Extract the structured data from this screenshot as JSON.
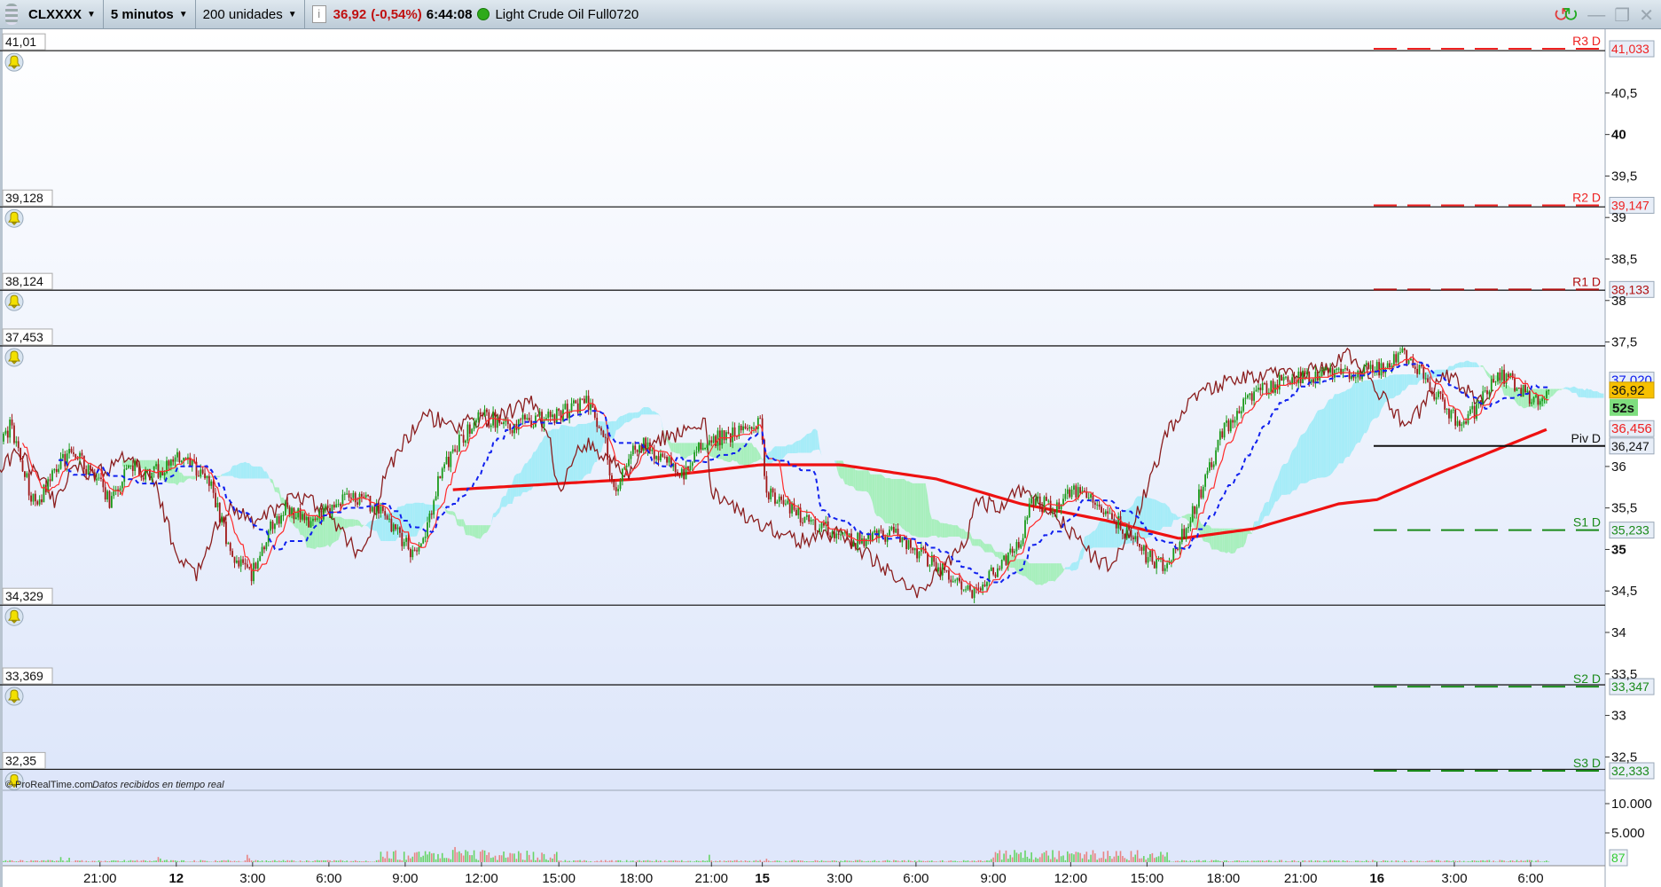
{
  "toolbar": {
    "symbol": "CLXXXX",
    "timeframe": "5 minutos",
    "units": "200 unidades",
    "price": "36,92",
    "change": "(-0,54%)",
    "time": "6:44:08",
    "instrument": "Light Crude Oil Full0720"
  },
  "colors": {
    "up": "#1a9a1a",
    "down": "#a01818",
    "tenkan": "#ff2a2a",
    "kijun": "#1020ee",
    "chikou": "#8b1e1e",
    "ma": "#ee1111",
    "cloud_bull": "#a6ecf8",
    "cloud_bear": "#a8efbd",
    "vol_up": "#66d466",
    "vol_down": "#e88484"
  },
  "user_lines": [
    {
      "label": "41,01",
      "price": 41.01
    },
    {
      "label": "39,128",
      "price": 39.128
    },
    {
      "label": "38,124",
      "price": 38.124
    },
    {
      "label": "37,453",
      "price": 37.453
    },
    {
      "label": "34,329",
      "price": 34.329
    },
    {
      "label": "33,369",
      "price": 33.369
    },
    {
      "label": "32,35",
      "price": 32.35
    }
  ],
  "pivots": [
    {
      "name": "R3 D",
      "value": 41.033,
      "label": "41,033",
      "color": "#ee2020",
      "style": "dashed"
    },
    {
      "name": "R2 D",
      "value": 39.147,
      "label": "39,147",
      "color": "#ee2020",
      "style": "dashed"
    },
    {
      "name": "R1 D",
      "value": 38.133,
      "label": "38,133",
      "color": "#b01010",
      "style": "dashed"
    },
    {
      "name": "Piv D",
      "value": 36.247,
      "label": "36,247",
      "color": "#111111",
      "style": "solid"
    },
    {
      "name": "S1 D",
      "value": 35.233,
      "label": "35,233",
      "color": "#1a8a1a",
      "style": "dashed"
    },
    {
      "name": "S2 D",
      "value": 33.347,
      "label": "33,347",
      "color": "#1a8a1a",
      "style": "dashed"
    },
    {
      "name": "S3 D",
      "value": 32.333,
      "label": "32,333",
      "color": "#1a8a1a",
      "style": "dashed"
    }
  ],
  "price_axis": {
    "ticks": [
      {
        "value": 40.5,
        "label": "40,5",
        "bold": false
      },
      {
        "value": 40,
        "label": "40",
        "bold": true
      },
      {
        "value": 39.5,
        "label": "39,5",
        "bold": false
      },
      {
        "value": 39,
        "label": "39",
        "bold": false
      },
      {
        "value": 38.5,
        "label": "38,5",
        "bold": false
      },
      {
        "value": 38,
        "label": "38",
        "bold": false
      },
      {
        "value": 37.5,
        "label": "37,5",
        "bold": false
      },
      {
        "value": 36,
        "label": "36",
        "bold": false
      },
      {
        "value": 35.5,
        "label": "35,5",
        "bold": false
      },
      {
        "value": 35,
        "label": "35",
        "bold": true
      },
      {
        "value": 34.5,
        "label": "34,5",
        "bold": false
      },
      {
        "value": 34,
        "label": "34",
        "bold": false
      },
      {
        "value": 33.5,
        "label": "33,5",
        "bold": false
      },
      {
        "value": 33,
        "label": "33",
        "bold": false
      },
      {
        "value": 32.5,
        "label": "32,5",
        "bold": false
      }
    ]
  },
  "price_labels": {
    "kijun": {
      "value": 37.02,
      "label": "37,020"
    },
    "last": {
      "value": 36.92,
      "label": "36,92"
    },
    "countdown": "52s",
    "ma": {
      "value": 36.456,
      "label": "36,456"
    }
  },
  "volume_axis": {
    "ticks": [
      {
        "value": 10000,
        "label": "10.000"
      },
      {
        "value": 5000,
        "label": "5.000"
      }
    ],
    "last": "87"
  },
  "time_axis": [
    {
      "bar": 45.5,
      "label": "21:00",
      "bold": false
    },
    {
      "bar": 81.5,
      "label": "12",
      "bold": true
    },
    {
      "bar": 117.5,
      "label": "3:00",
      "bold": false
    },
    {
      "bar": 153.5,
      "label": "6:00",
      "bold": false
    },
    {
      "bar": 189.5,
      "label": "9:00",
      "bold": false
    },
    {
      "bar": 225.5,
      "label": "12:00",
      "bold": false
    },
    {
      "bar": 262,
      "label": "15:00",
      "bold": false
    },
    {
      "bar": 298.5,
      "label": "18:00",
      "bold": false
    },
    {
      "bar": 334,
      "label": "21:00",
      "bold": false
    },
    {
      "bar": 358,
      "label": "15",
      "bold": true
    },
    {
      "bar": 394.5,
      "label": "3:00",
      "bold": false
    },
    {
      "bar": 430.5,
      "label": "6:00",
      "bold": false
    },
    {
      "bar": 467,
      "label": "9:00",
      "bold": false
    },
    {
      "bar": 503.5,
      "label": "12:00",
      "bold": false
    },
    {
      "bar": 539.5,
      "label": "15:00",
      "bold": false
    },
    {
      "bar": 575.5,
      "label": "18:00",
      "bold": false
    },
    {
      "bar": 612,
      "label": "21:00",
      "bold": false
    },
    {
      "bar": 648,
      "label": "16",
      "bold": true
    },
    {
      "bar": 684.5,
      "label": "3:00",
      "bold": false
    },
    {
      "bar": 720.5,
      "label": "6:00",
      "bold": false
    }
  ],
  "footer": {
    "copyright": "© ProRealTime.com",
    "status": "Datos recibidos en tiempo real"
  },
  "chart_data": {
    "type": "candlestick",
    "price_path": [
      [
        0,
        36.3
      ],
      [
        3,
        36.5
      ],
      [
        15,
        35.5
      ],
      [
        25,
        36.0
      ],
      [
        33,
        36.2
      ],
      [
        45,
        35.8
      ],
      [
        50,
        35.6
      ],
      [
        60,
        36.0
      ],
      [
        70,
        35.9
      ],
      [
        82,
        36.1
      ],
      [
        95,
        35.9
      ],
      [
        100,
        35.6
      ],
      [
        108,
        34.9
      ],
      [
        117,
        34.7
      ],
      [
        125,
        35.2
      ],
      [
        133,
        35.5
      ],
      [
        145,
        35.3
      ],
      [
        160,
        35.6
      ],
      [
        170,
        35.6
      ],
      [
        180,
        35.4
      ],
      [
        195,
        34.9
      ],
      [
        200,
        35.3
      ],
      [
        206,
        35.9
      ],
      [
        215,
        36.3
      ],
      [
        225,
        36.6
      ],
      [
        240,
        36.5
      ],
      [
        260,
        36.6
      ],
      [
        275,
        36.8
      ],
      [
        283,
        36.4
      ],
      [
        288,
        35.7
      ],
      [
        295,
        36.1
      ],
      [
        300,
        36.3
      ],
      [
        310,
        36.1
      ],
      [
        320,
        35.9
      ],
      [
        330,
        36.3
      ],
      [
        345,
        36.4
      ],
      [
        357,
        36.5
      ],
      [
        360,
        35.7
      ],
      [
        370,
        35.5
      ],
      [
        385,
        35.3
      ],
      [
        400,
        35.1
      ],
      [
        420,
        35.2
      ],
      [
        435,
        34.9
      ],
      [
        450,
        34.6
      ],
      [
        458,
        34.5
      ],
      [
        470,
        34.8
      ],
      [
        480,
        35.1
      ],
      [
        485,
        35.6
      ],
      [
        495,
        35.5
      ],
      [
        505,
        35.7
      ],
      [
        520,
        35.5
      ],
      [
        530,
        35.2
      ],
      [
        540,
        34.9
      ],
      [
        548,
        34.8
      ],
      [
        555,
        35.1
      ],
      [
        565,
        35.7
      ],
      [
        575,
        36.4
      ],
      [
        585,
        36.8
      ],
      [
        600,
        37.0
      ],
      [
        615,
        37.1
      ],
      [
        635,
        37.1
      ],
      [
        650,
        37.2
      ],
      [
        660,
        37.35
      ],
      [
        670,
        37.1
      ],
      [
        680,
        36.7
      ],
      [
        688,
        36.5
      ],
      [
        695,
        36.7
      ],
      [
        705,
        37.15
      ],
      [
        715,
        36.95
      ],
      [
        722,
        36.8
      ],
      [
        729,
        36.92
      ]
    ],
    "ma_path": [
      [
        212,
        35.72
      ],
      [
        300,
        35.85
      ],
      [
        357,
        36.02
      ],
      [
        395,
        36.02
      ],
      [
        440,
        35.85
      ],
      [
        480,
        35.55
      ],
      [
        520,
        35.35
      ],
      [
        555,
        35.13
      ],
      [
        590,
        35.25
      ],
      [
        630,
        35.55
      ],
      [
        648,
        35.6
      ],
      [
        680,
        35.95
      ],
      [
        729,
        36.456
      ]
    ],
    "volume_range": [
      0,
      10000
    ]
  }
}
